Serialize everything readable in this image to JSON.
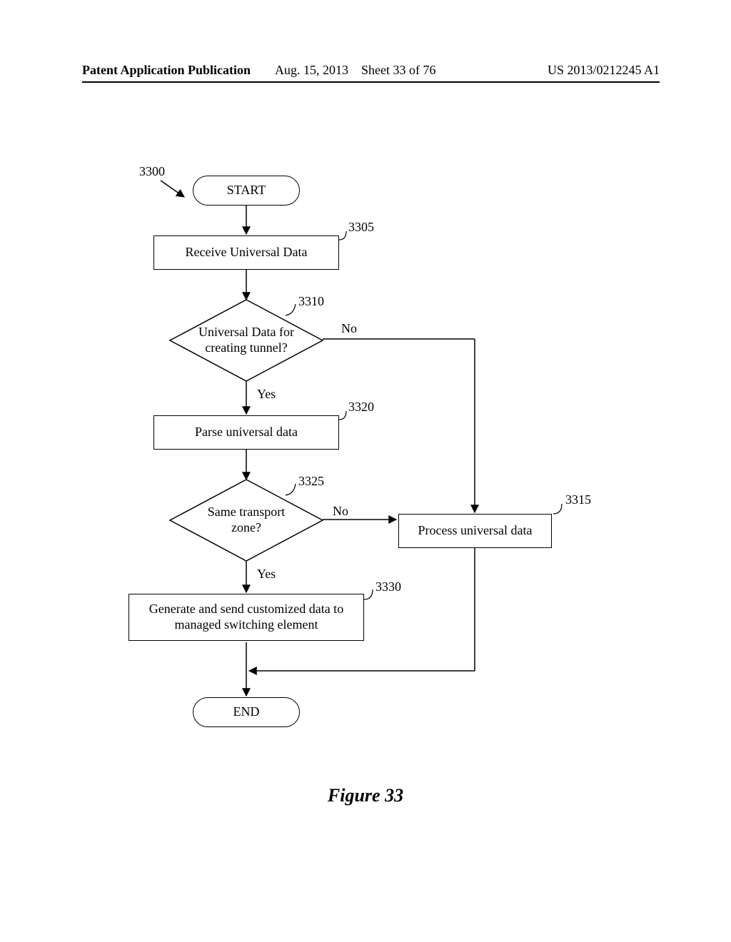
{
  "header": {
    "left": "Patent Application Publication",
    "date": "Aug. 15, 2013",
    "sheet": "Sheet 33 of 76",
    "pubno": "US 2013/0212245 A1"
  },
  "flow": {
    "ref3300": "3300",
    "start": "START",
    "n3305": {
      "ref": "3305",
      "text": "Receive Universal Data"
    },
    "n3310": {
      "ref": "3310",
      "text": "Universal Data for creating tunnel?",
      "yes": "Yes",
      "no": "No"
    },
    "n3320": {
      "ref": "3320",
      "text": "Parse universal data"
    },
    "n3325": {
      "ref": "3325",
      "text": "Same transport zone?",
      "yes": "Yes",
      "no": "No"
    },
    "n3315": {
      "ref": "3315",
      "text": "Process universal data"
    },
    "n3330": {
      "ref": "3330",
      "text": "Generate and send customized data to managed switching element"
    },
    "end": "END"
  },
  "caption": "Figure 33"
}
